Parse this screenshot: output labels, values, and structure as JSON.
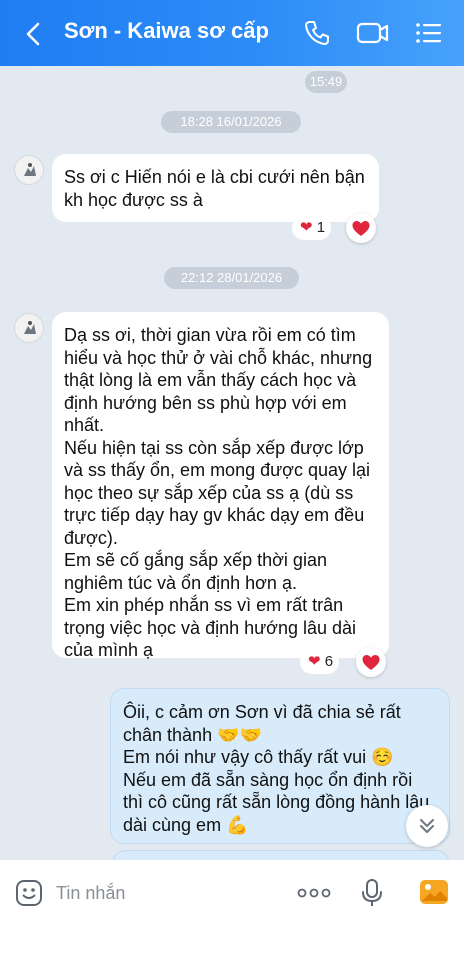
{
  "header": {
    "title": "Sơn - Kaiwa sơ cấp",
    "icons": [
      "back-icon",
      "phone-icon",
      "video-call-icon",
      "menu-icon"
    ]
  },
  "timestamps": {
    "t0": "15:49",
    "t1": "18:28 16/01/2026",
    "t2": "22:12 28/01/2026"
  },
  "messages": [
    {
      "direction": "incoming",
      "text": "Ss ơi c Hiến nói e là cbi cưới nên bận\nkh học được ss à",
      "reaction_count": "1"
    },
    {
      "direction": "incoming",
      "text": "Dạ ss ơi, thời gian vừa rồi em có tìm\nhiểu và học thử ở vài chỗ khác, nhưng\nthật lòng là em vẫn thấy cách học và\nđịnh hướng bên ss phù hợp với em\nnhất.\nNếu hiện tại ss còn sắp xếp được lớp\nvà ss thấy ổn, em mong được quay lại\nhọc theo sự sắp xếp của ss ạ (dù ss\ntrực tiếp dạy hay gv khác dạy em đều\nđược).\nEm sẽ cố gắng sắp xếp thời gian\nnghiêm túc và ổn định hơn ạ.\nEm xin phép nhắn ss vì em rất trân\ntrọng việc học và định hướng lâu dài\ncủa mình ạ",
      "reaction_count": "6"
    },
    {
      "direction": "outgoing",
      "text": "Ôii, c cảm ơn Sơn vì đã chia sẻ rất\nchân thành 🤝🤝\nEm nói như vậy cô thấy rất vui ☺️\nNếu em đã sẵn sàng học ổn định rồi\nthì cô cũng rất sẵn lòng đồng hành lâu\ndài cùng em 💪"
    }
  ],
  "input_bar": {
    "placeholder": "Tin nhắn",
    "icons": [
      "emoji-icon",
      "more-icon",
      "microphone-icon",
      "image-icon"
    ]
  },
  "colors": {
    "header_start": "#1f7df2",
    "header_end": "#46a2fb",
    "chat_background": "#e2e9f1",
    "outgoing_bubble": "#d7ebfb",
    "incoming_bubble": "#ffffff",
    "heart": "#e0263d"
  }
}
